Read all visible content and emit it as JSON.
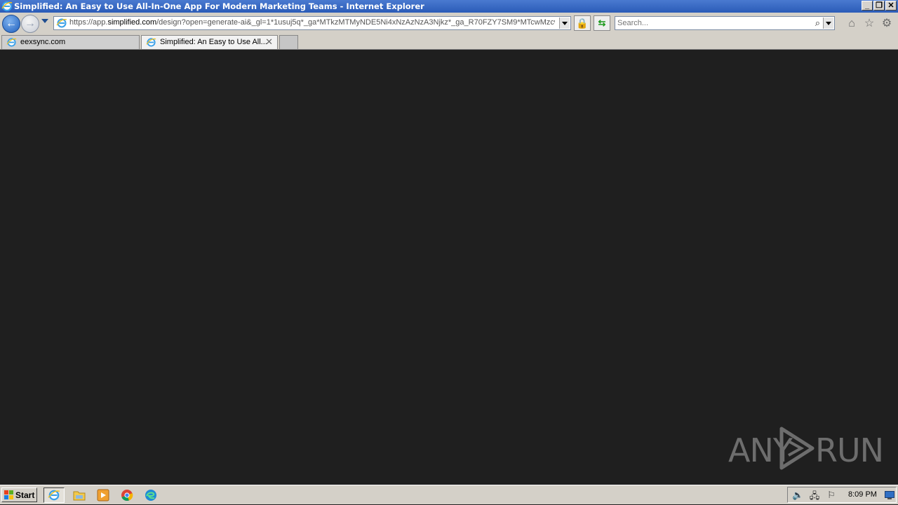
{
  "window": {
    "title": "Simplified: An Easy to Use All-In-One App For Modern Marketing Teams - Internet Explorer",
    "minimize": "_",
    "restore": "❐",
    "close": "✕"
  },
  "nav": {
    "url_scheme": "https://app.",
    "url_host": "simplified.com",
    "url_rest": "/design?open=generate-ai&_gl=1*1usuj5q*_ga*MTkzMTMyNDE5Ni4xNzAzNzA3Njkz*_ga_R70FZY7SM9*MTcwMzcwNz",
    "search_placeholder": "Search..."
  },
  "tabs": [
    {
      "label": "eexsync.com",
      "active": false
    },
    {
      "label": "Simplified: An Easy to Use All...",
      "active": true
    }
  ],
  "watermark": {
    "left": "ANY",
    "right": "RUN"
  },
  "taskbar": {
    "start_label": "Start",
    "clock": "8:09 PM"
  }
}
